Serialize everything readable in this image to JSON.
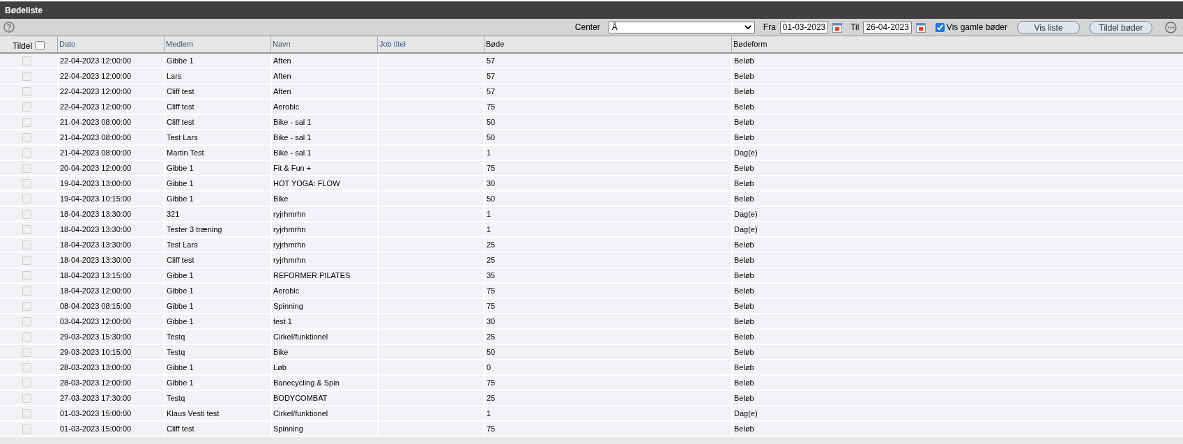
{
  "window": {
    "title": "Bødeliste"
  },
  "toolbar": {
    "center_label": "Center",
    "center_value": "Å",
    "from_label": "Fra",
    "from_value": "01-03-2023",
    "to_label": "Til",
    "to_value": "26-04-2023",
    "show_old": {
      "label": "Vis gamle bøder",
      "checked": true
    },
    "buttons": [
      "Vis liste",
      "Tildel bøder"
    ]
  },
  "table": {
    "select_all": {
      "label": "Tildel",
      "checked": false
    },
    "columns": [
      "Dato",
      "Medlem",
      "Navn",
      "Job titel",
      "Bøde",
      "Bødeform"
    ],
    "rows": [
      {
        "checked": false,
        "cells": [
          "22-04-2023 12:00:00",
          "Gibbe 1",
          "Aften",
          "",
          "57",
          "Beløb"
        ]
      },
      {
        "checked": false,
        "cells": [
          "22-04-2023 12:00:00",
          "Lars",
          "Aften",
          "",
          "57",
          "Beløb"
        ]
      },
      {
        "checked": false,
        "cells": [
          "22-04-2023 12:00:00",
          "Cliff test",
          "Aften",
          "",
          "57",
          "Beløb"
        ]
      },
      {
        "checked": false,
        "cells": [
          "22-04-2023 12:00:00",
          "Cliff test",
          "Aerobic",
          "",
          "75",
          "Beløb"
        ]
      },
      {
        "checked": false,
        "cells": [
          "21-04-2023 08:00:00",
          "Cliff test",
          "Bike - sal 1",
          "",
          "50",
          "Beløb"
        ]
      },
      {
        "checked": false,
        "cells": [
          "21-04-2023 08:00:00",
          "Test Lars",
          "Bike - sal 1",
          "",
          "50",
          "Beløb"
        ]
      },
      {
        "checked": false,
        "cells": [
          "21-04-2023 08:00:00",
          "Martin Test",
          "Bike - sal 1",
          "",
          "1",
          "Dag(e)"
        ]
      },
      {
        "checked": false,
        "cells": [
          "20-04-2023 12:00:00",
          "Gibbe 1",
          "Fit & Fun +",
          "",
          "75",
          "Beløb"
        ]
      },
      {
        "checked": false,
        "cells": [
          "19-04-2023 13:00:00",
          "Gibbe 1",
          "HOT YOGA: FLOW",
          "",
          "30",
          "Beløb"
        ]
      },
      {
        "checked": false,
        "cells": [
          "19-04-2023 10:15:00",
          "Gibbe 1",
          "Bike",
          "",
          "50",
          "Beløb"
        ]
      },
      {
        "checked": false,
        "cells": [
          "18-04-2023 13:30:00",
          "321",
          "ryjrhmrhn",
          "",
          "1",
          "Dag(e)"
        ]
      },
      {
        "checked": false,
        "cells": [
          "18-04-2023 13:30:00",
          "Tester 3 træning",
          "ryjrhmrhn",
          "",
          "1",
          "Dag(e)"
        ]
      },
      {
        "checked": false,
        "cells": [
          "18-04-2023 13:30:00",
          "Test Lars",
          "ryjrhmrhn",
          "",
          "25",
          "Beløb"
        ]
      },
      {
        "checked": false,
        "cells": [
          "18-04-2023 13:30:00",
          "Cliff test",
          "ryjrhmrhn",
          "",
          "25",
          "Beløb"
        ]
      },
      {
        "checked": false,
        "cells": [
          "18-04-2023 13:15:00",
          "Gibbe 1",
          "REFORMER PILATES",
          "",
          "35",
          "Beløb"
        ]
      },
      {
        "checked": false,
        "cells": [
          "18-04-2023 12:00:00",
          "Gibbe 1",
          "Aerobic",
          "",
          "75",
          "Beløb"
        ]
      },
      {
        "checked": false,
        "cells": [
          "08-04-2023 08:15:00",
          "Gibbe 1",
          "Spinning",
          "",
          "75",
          "Beløb"
        ]
      },
      {
        "checked": false,
        "cells": [
          "03-04-2023 12:00:00",
          "Gibbe 1",
          "test 1",
          "",
          "30",
          "Beløb"
        ]
      },
      {
        "checked": false,
        "cells": [
          "29-03-2023 15:30:00",
          "Testq",
          "Cirkel/funktionel",
          "",
          "25",
          "Beløb"
        ]
      },
      {
        "checked": false,
        "cells": [
          "29-03-2023 10:15:00",
          "Testq",
          "Bike",
          "",
          "50",
          "Beløb"
        ]
      },
      {
        "checked": false,
        "cells": [
          "28-03-2023 13:00:00",
          "Gibbe 1",
          "Løb",
          "",
          "0",
          "Beløb"
        ]
      },
      {
        "checked": false,
        "cells": [
          "28-03-2023 12:00:00",
          "Gibbe 1",
          "Banecycling & Spin",
          "",
          "75",
          "Beløb"
        ]
      },
      {
        "checked": false,
        "cells": [
          "27-03-2023 17:30:00",
          "Testq",
          "BODYCOMBAT",
          "",
          "25",
          "Beløb"
        ]
      },
      {
        "checked": false,
        "cells": [
          "01-03-2023 15:00:00",
          "Klaus Vesti test",
          "Cirkel/funktionel",
          "",
          "1",
          "Dag(e)"
        ]
      },
      {
        "checked": false,
        "cells": [
          "01-03-2023 15:00:00",
          "Cliff test",
          "Spinning",
          "",
          "75",
          "Beløb"
        ]
      }
    ]
  }
}
